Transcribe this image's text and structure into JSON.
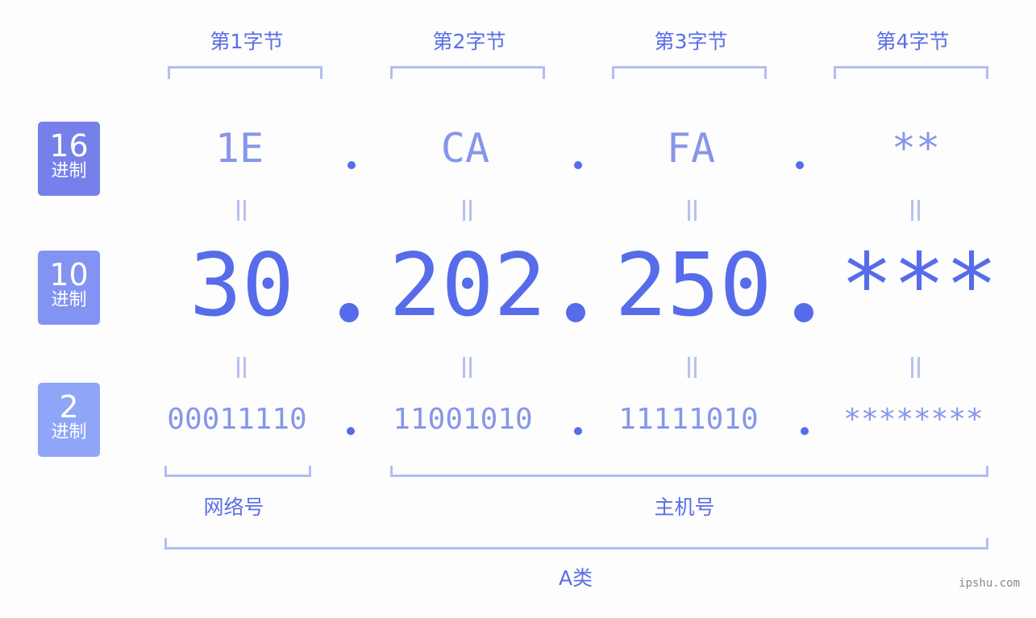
{
  "byte_headers": [
    "第1字节",
    "第2字节",
    "第3字节",
    "第4字节"
  ],
  "rows": {
    "hex": {
      "badge_num": "16",
      "badge_label": "进制",
      "badge_color": "#7680ea",
      "values": [
        "1E",
        "CA",
        "FA",
        "**"
      ]
    },
    "dec": {
      "badge_num": "10",
      "badge_label": "进制",
      "badge_color": "#8393f2",
      "values": [
        "30",
        "202",
        "250",
        "***"
      ]
    },
    "bin": {
      "badge_num": "2",
      "badge_label": "进制",
      "badge_color": "#8fa6f8",
      "values": [
        "00011110",
        "11001010",
        "11111010",
        "********"
      ]
    }
  },
  "separator": ".",
  "segments": {
    "network": "网络号",
    "host": "主机号",
    "class": "A类"
  },
  "watermark": "ipshu.com",
  "colors": {
    "accent": "#566ceb",
    "light": "#8696ea",
    "bracket": "#b4bcf4"
  }
}
